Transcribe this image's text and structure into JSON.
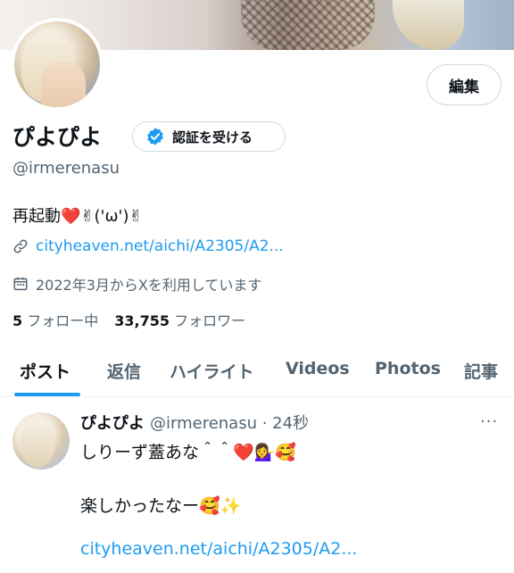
{
  "profile": {
    "name": "ぴよぴよ",
    "verify_label": "認証を受ける",
    "handle": "@irmerenasu",
    "bio": "再起動❤️✌︎('ω')✌︎",
    "link": "cityheaven.net/aichi/A2305/A2...",
    "joined": "2022年3月からXを利用しています",
    "following_count": "5",
    "following_label": "フォロー中",
    "followers_count": "33,755",
    "followers_label": "フォロワー",
    "edit_label": "編集"
  },
  "tabs": [
    "ポスト",
    "返信",
    "ハイライト",
    "Videos",
    "Photos",
    "記事"
  ],
  "tweet": {
    "name": "ぴよぴよ",
    "handle_time": "@irmerenasu · 24秒",
    "more": "···",
    "line1": "しりーず蓋あな＾＾❤️💁‍♀️🥰",
    "line2": "楽しかったなー🥰✨",
    "link": "cityheaven.net/aichi/A2305/A2..."
  },
  "colors": {
    "accent": "#1d9bf0",
    "text": "#0f1419",
    "muted": "#536471"
  }
}
